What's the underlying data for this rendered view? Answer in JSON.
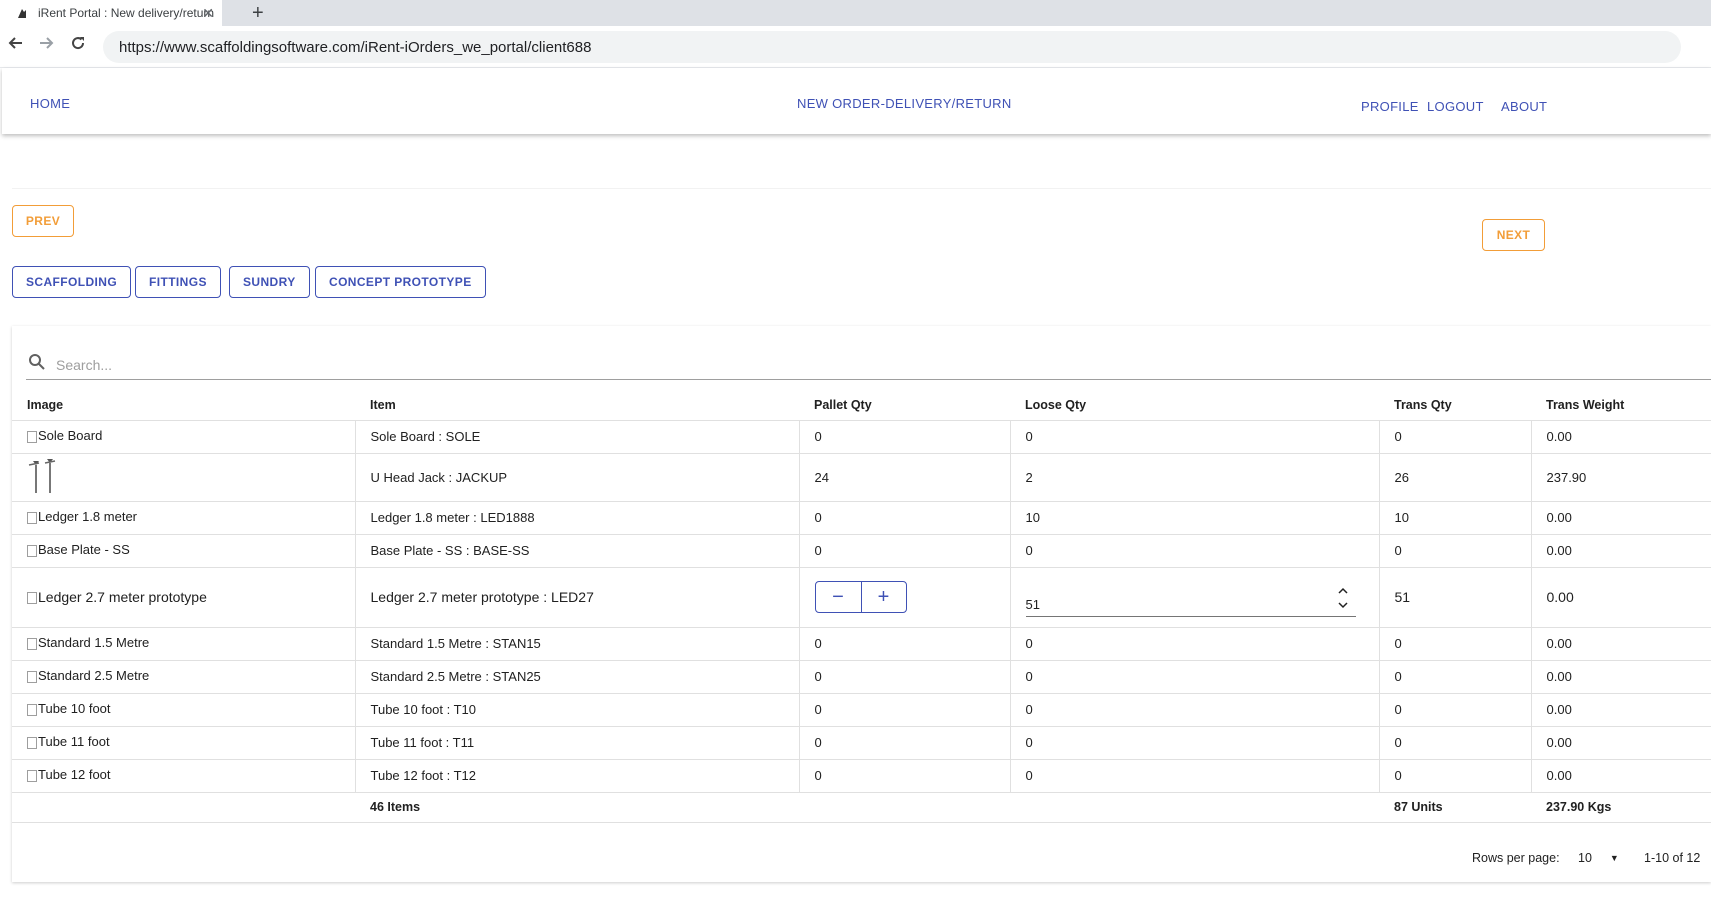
{
  "browser": {
    "tab_title": "iRent Portal : New delivery/return",
    "url": "https://www.scaffoldingsoftware.com/iRent-iOrders_we_portal/client688"
  },
  "nav": {
    "home": "HOME",
    "new_order": "NEW ORDER-DELIVERY/RETURN",
    "profile": "PROFILE",
    "logout": "LOGOUT",
    "about": "ABOUT"
  },
  "controls": {
    "prev": "PREV",
    "next": "NEXT",
    "categories": [
      "SCAFFOLDING",
      "FITTINGS",
      "SUNDRY",
      "CONCEPT PROTOTYPE"
    ]
  },
  "search": {
    "placeholder": "Search..."
  },
  "table": {
    "columns": [
      "Image",
      "Item",
      "Pallet Qty",
      "Loose Qty",
      "Trans Qty",
      "Trans Weight"
    ],
    "rows": [
      {
        "image": "Sole Board",
        "item": "Sole Board : SOLE",
        "pallet": "0",
        "loose": "0",
        "trans": "0",
        "weight": "0.00"
      },
      {
        "image": "",
        "item": "U Head Jack : JACKUP",
        "pallet": "24",
        "loose": "2",
        "trans": "26",
        "weight": "237.90"
      },
      {
        "image": "Ledger 1.8 meter",
        "item": "Ledger 1.8 meter : LED1888",
        "pallet": "0",
        "loose": "10",
        "trans": "10",
        "weight": "0.00"
      },
      {
        "image": "Base Plate - SS",
        "item": "Base Plate - SS : BASE-SS",
        "pallet": "0",
        "loose": "0",
        "trans": "0",
        "weight": "0.00"
      },
      {
        "image": "Ledger 2.7 meter prototype",
        "item": "Ledger 2.7 meter prototype : LED27",
        "pallet": "",
        "loose": "51",
        "trans": "51",
        "weight": "0.00"
      },
      {
        "image": "Standard 1.5 Metre",
        "item": "Standard 1.5 Metre : STAN15",
        "pallet": "0",
        "loose": "0",
        "trans": "0",
        "weight": "0.00"
      },
      {
        "image": "Standard 2.5 Metre",
        "item": "Standard 2.5 Metre : STAN25",
        "pallet": "0",
        "loose": "0",
        "trans": "0",
        "weight": "0.00"
      },
      {
        "image": "Tube 10 foot",
        "item": "Tube 10 foot : T10",
        "pallet": "0",
        "loose": "0",
        "trans": "0",
        "weight": "0.00"
      },
      {
        "image": "Tube 11 foot",
        "item": "Tube 11 foot : T11",
        "pallet": "0",
        "loose": "0",
        "trans": "0",
        "weight": "0.00"
      },
      {
        "image": "Tube 12 foot",
        "item": "Tube 12 foot : T12",
        "pallet": "0",
        "loose": "0",
        "trans": "0",
        "weight": "0.00"
      }
    ],
    "footer": {
      "items": "46 Items",
      "units": "87 Units",
      "weight": "237.90 Kgs"
    }
  },
  "pagination": {
    "rows_per_page_label": "Rows per page:",
    "rows_per_page": "10",
    "range": "1-10 of 12"
  },
  "colors": {
    "accent_blue": "#3f51b5",
    "accent_orange": "#f29d38"
  }
}
